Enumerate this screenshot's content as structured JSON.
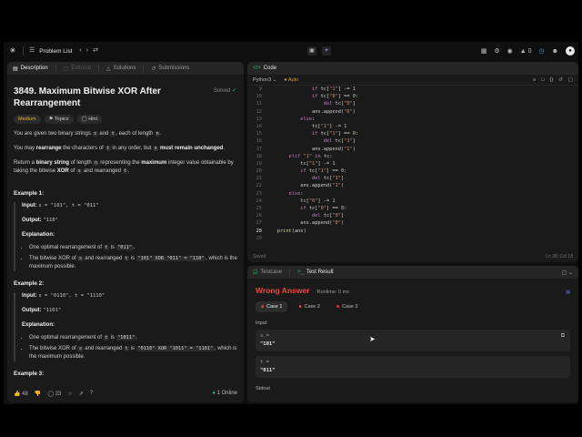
{
  "topbar": {
    "problem_list": "Problem List",
    "points": "0"
  },
  "description": {
    "tabs": [
      {
        "label": "Description"
      },
      {
        "label": "Editorial"
      },
      {
        "label": "Solutions"
      },
      {
        "label": "Submissions"
      }
    ],
    "title": "3849. Maximum Bitwise XOR After Rearrangement",
    "solved": "Solved",
    "chips": {
      "difficulty": "Medium",
      "topics": "Topics",
      "hint": "Hint"
    },
    "p1": {
      "a": "You are given two binary strings ",
      "s": "s",
      "b": " and ",
      "t": "t",
      "c": ", each of length ",
      "n": "n",
      "d": "."
    },
    "p2": {
      "a": "You may ",
      "bold1": "rearrange",
      "b": " the characters of ",
      "t": "t",
      "c": " in any order, but ",
      "s": "s",
      "bold2": "must remain unchanged",
      "d": "."
    },
    "p3": {
      "a": "Return a ",
      "bold1": "binary string",
      "b": " of length ",
      "n": "n",
      "c": " representing the ",
      "bold2": "maximum",
      "d": " integer value obtainable by taking the bitwise ",
      "bold3": "XOR",
      "e": " of ",
      "s": "s",
      "f": " and rearranged ",
      "t": "t",
      "g": "."
    },
    "examples": [
      {
        "heading": "Example 1:",
        "input_label": "Input:",
        "input": "s = \"101\", t = \"011\"",
        "output_label": "Output:",
        "output": "\"110\"",
        "expl_label": "Explanation:",
        "b1": {
          "a": "One optimal rearrangement of ",
          "t": "t",
          "b": " is ",
          "v": "\"011\"",
          "c": "."
        },
        "b2": {
          "a": "The bitwise XOR of ",
          "s": "s",
          "b": " and rearranged ",
          "t": "t",
          "c": " is ",
          "v": "\"101\" XOR \"011\" = \"110\"",
          "d": ", which is the maximum possible."
        }
      },
      {
        "heading": "Example 2:",
        "input_label": "Input:",
        "input": "s = \"0110\", t = \"1110\"",
        "output_label": "Output:",
        "output": "\"1101\"",
        "expl_label": "Explanation:",
        "b1": {
          "a": "One optimal rearrangement of ",
          "t": "t",
          "b": " is ",
          "v": "\"1011\"",
          "c": "."
        },
        "b2": {
          "a": "The bitwise XOR of ",
          "s": "s",
          "b": " and rearranged ",
          "t": "t",
          "c": " is ",
          "v": "\"0110\" XOR \"1011\" = \"1101\"",
          "d": ", which is the maximum possible."
        }
      }
    ],
    "example3_heading": "Example 3:",
    "footer": {
      "likes": "48",
      "comments": "23",
      "online": "1 Online"
    }
  },
  "code": {
    "tab": "Code",
    "language": "Python3",
    "auto": "Auto",
    "status": "Saved",
    "cursor_pos": "Ln 28, Col 18",
    "lines": [
      {
        "n": "9",
        "indent": 16,
        "html": "<span class='kw'>if</span> tc[<span class='st'>\"1\"</span>] -= <span class='nu'>1</span>"
      },
      {
        "n": "10",
        "indent": 16,
        "html": "<span class='kw'>if</span> tc[<span class='st'>\"0\"</span>] == <span class='nu'>0</span>:"
      },
      {
        "n": "11",
        "indent": 20,
        "html": "<span class='kw'>del</span> tc[<span class='st'>\"0\"</span>]"
      },
      {
        "n": "12",
        "indent": 16,
        "html": "ans.append(<span class='st'>\"0\"</span>)"
      },
      {
        "n": "13",
        "indent": 12,
        "html": "<span class='kw'>else</span>:"
      },
      {
        "n": "14",
        "indent": 16,
        "html": "tc[<span class='st'>\"1\"</span>] -= <span class='nu'>1</span>"
      },
      {
        "n": "15",
        "indent": 16,
        "html": "<span class='kw'>if</span> tc[<span class='st'>\"1\"</span>] == <span class='nu'>0</span>:"
      },
      {
        "n": "16",
        "indent": 20,
        "html": "<span class='kw'>del</span> tc[<span class='st'>\"1\"</span>]"
      },
      {
        "n": "17",
        "indent": 16,
        "html": "ans.append(<span class='st'>\"1\"</span>)"
      },
      {
        "n": "18",
        "indent": 8,
        "html": "<span class='kw'>elif</span> <span class='st'>\"1\"</span> <span class='kw'>in</span> tc:"
      },
      {
        "n": "19",
        "indent": 12,
        "html": "tc[<span class='st'>\"1\"</span>] -= <span class='nu'>1</span>"
      },
      {
        "n": "20",
        "indent": 12,
        "html": "<span class='kw'>if</span> tc[<span class='st'>\"1\"</span>] == <span class='nu'>0</span>:"
      },
      {
        "n": "21",
        "indent": 16,
        "html": "<span class='kw'>del</span> tc[<span class='st'>\"1\"</span>]"
      },
      {
        "n": "22",
        "indent": 12,
        "html": "ans.append(<span class='st'>\"1\"</span>)"
      },
      {
        "n": "23",
        "indent": 8,
        "html": "<span class='kw'>else</span>:"
      },
      {
        "n": "24",
        "indent": 12,
        "html": "tc[<span class='st'>\"0\"</span>] -= <span class='nu'>1</span>"
      },
      {
        "n": "25",
        "indent": 12,
        "html": "<span class='kw'>if</span> tc[<span class='st'>\"0\"</span>] == <span class='nu'>0</span>:"
      },
      {
        "n": "26",
        "indent": 16,
        "html": "<span class='kw'>del</span> tc[<span class='st'>\"0\"</span>]"
      },
      {
        "n": "27",
        "indent": 12,
        "html": "ans.append(<span class='st'>\"0\"</span>)"
      },
      {
        "n": "28",
        "indent": 4,
        "html": "<span class='fn'>print</span>(ans)"
      },
      {
        "n": "29",
        "indent": 0,
        "html": ""
      }
    ]
  },
  "test": {
    "tabs": [
      {
        "label": "Testcase"
      },
      {
        "label": "Test Result"
      }
    ],
    "verdict": "Wrong Answer",
    "runtime": "Runtime: 0 ms",
    "cases": [
      {
        "label": "Case 1"
      },
      {
        "label": "Case 2"
      },
      {
        "label": "Case 3"
      }
    ],
    "input_label": "Input",
    "inputs": [
      {
        "name": "s =",
        "value": "\"101\""
      },
      {
        "name": "t =",
        "value": "\"011\""
      }
    ],
    "stdout_label": "Stdout"
  },
  "colors": {
    "wrong": "#ef4743",
    "medium": "#f0b429",
    "accent": "#8e7cf0",
    "keyword": "#c586c0",
    "string": "#ce9178"
  }
}
